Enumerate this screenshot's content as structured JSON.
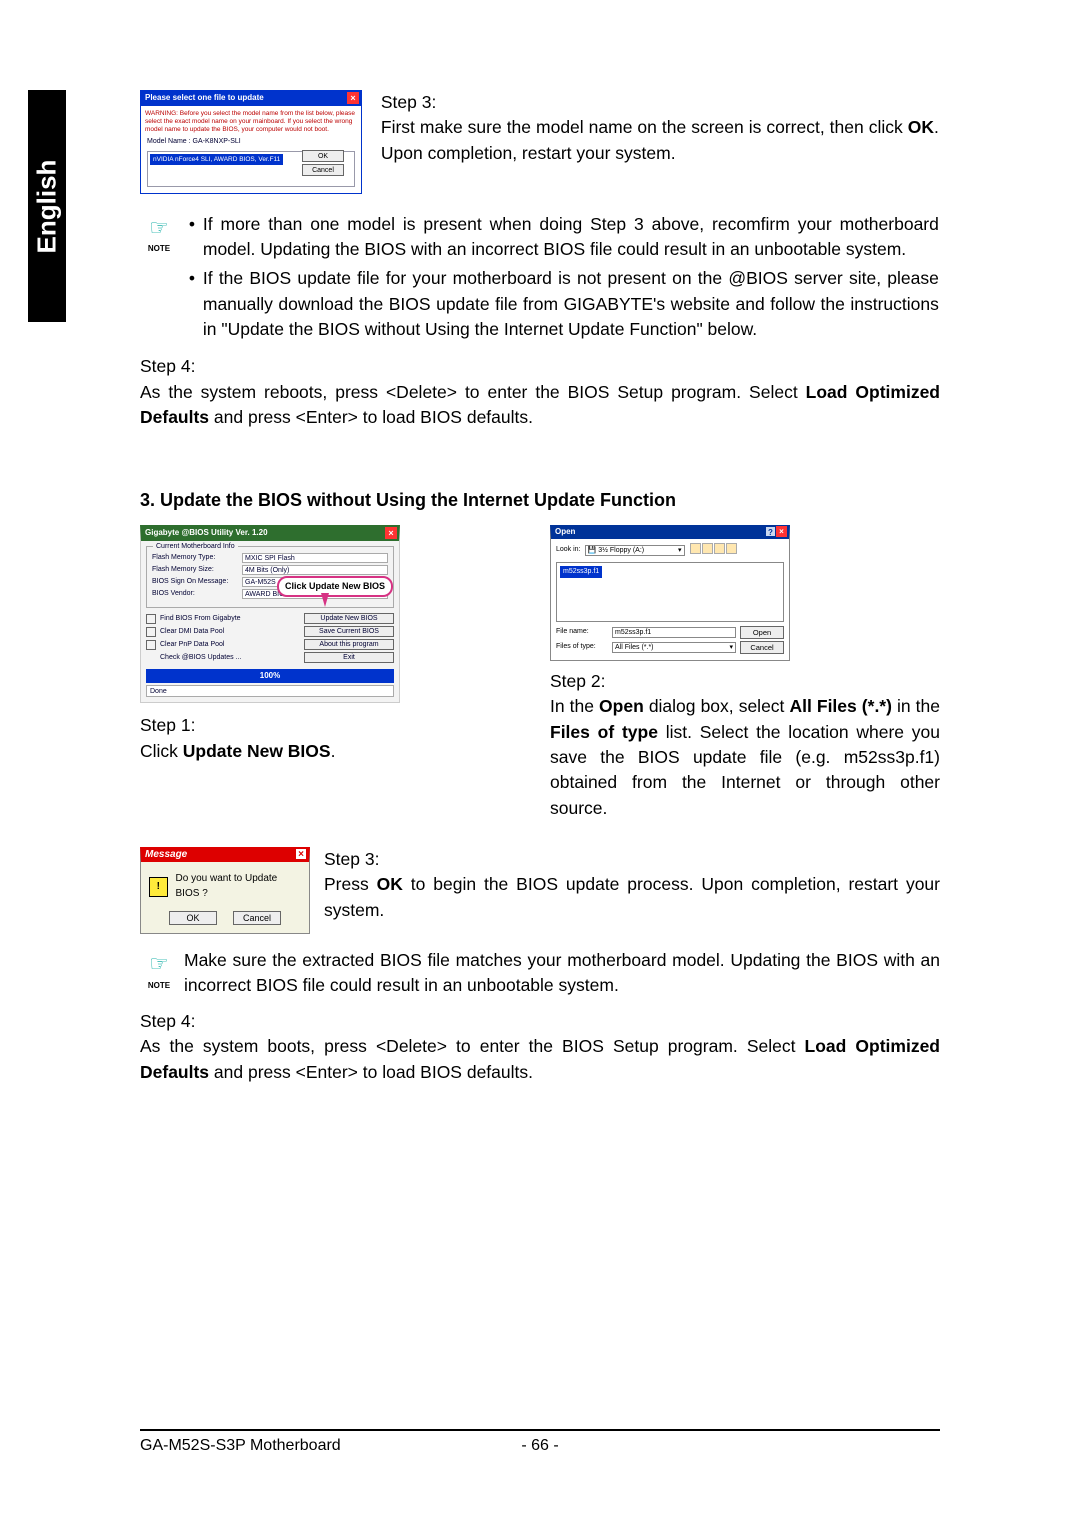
{
  "side_tab": "English",
  "select_dialog": {
    "title": "Please select one file to update",
    "warning": "WARNING: Before you select the model name from the list below, please select the exact model name on your mainboard. If you select the wrong model name to update the BIOS, your computer would not boot.",
    "model_label": "Model Name : GA-K8NXP-SLI",
    "list_item": "nVIDIA nForce4 SLI, AWARD BIOS, Ver.F11",
    "ok": "OK",
    "cancel": "Cancel"
  },
  "step3a": {
    "heading": "Step 3:",
    "p1a": "First make sure the model name on the screen is correct, then click ",
    "p1b": "OK",
    "p1c": ". Upon completion, restart your system."
  },
  "note1": {
    "label": "NOTE",
    "li1": "If more than one model is present when doing Step 3 above, recomfirm your motherboard model. Updating the BIOS with an incorrect BIOS file could result in an unbootable system.",
    "li2": "If the BIOS update file for your motherboard is not present on the @BIOS server site, please manually download the BIOS update file from GIGABYTE's website and follow the instructions in \"Update the BIOS without Using the Internet Update Function\" below."
  },
  "step4a": {
    "heading": "Step 4:",
    "p_a": "As the system reboots, press <Delete> to enter the BIOS Setup program. Select ",
    "p_b": "Load Optimized Defaults",
    "p_c": " and press <Enter> to load BIOS defaults."
  },
  "section3_title": "3.   Update the BIOS without Using the Internet Update Function",
  "utility": {
    "title": "Gigabyte @BIOS Utility Ver. 1.20",
    "group_label": "Current Motherboard Info",
    "r1l": "Flash Memory Type:",
    "r1v": "MXIC SPI Flash",
    "r2l": "Flash Memory Size:",
    "r2v": "4M Bits (Only)",
    "r3l": "BIOS Sign On Message:",
    "r3v": "GA-M52S",
    "r4l": "BIOS Vendor:",
    "r4v": "AWARD BIOS",
    "b1c": "Find BIOS From Gigabyte",
    "b1b": "Update New BIOS",
    "b2c": "Clear DMI Data Pool",
    "b2b": "Save Current BIOS",
    "b3c": "Clear PnP Data Pool",
    "b3b": "About this program",
    "b4c": "Check @BIOS Updates ...",
    "b4b": "Exit",
    "progress": "100%",
    "done": "Done",
    "callout": "Click Update New BIOS"
  },
  "step1": {
    "heading": "Step 1:",
    "p_a": "Click ",
    "p_b": "Update New BIOS",
    "p_c": "."
  },
  "open_dialog": {
    "title": "Open",
    "look_in_label": "Look in:",
    "look_in": "3½ Floppy (A:)",
    "file": "m52ss3p.f1",
    "filename_label": "File name:",
    "filename": "m52ss3p.f1",
    "filetype_label": "Files of type:",
    "filetype": "All Files (*.*)",
    "open": "Open",
    "cancel": "Cancel"
  },
  "step2": {
    "heading": "Step 2:",
    "p_a": "In the ",
    "p_b": "Open",
    "p_c": " dialog box, select  ",
    "p_d": "All Files (*.*)",
    "p_e": " in the ",
    "p_f": "Files of type",
    "p_g": " list. Select the location where you save the BIOS update file (e.g. m52ss3p.f1) obtained from the Internet or through other source."
  },
  "msg": {
    "title": "Message",
    "text": "Do you want to Update BIOS ?",
    "ok": "OK",
    "cancel": "Cancel"
  },
  "step3b": {
    "heading": "Step 3:",
    "p_a": "Press ",
    "p_b": "OK",
    "p_c": " to begin the BIOS update process. Upon completion, restart your system."
  },
  "note2": {
    "label": "NOTE",
    "text": "Make sure the extracted BIOS file matches your motherboard model. Updating the BIOS with an incorrect BIOS file could result in an unbootable system."
  },
  "step4b": {
    "heading": "Step 4:",
    "p_a": "As the system boots, press <Delete> to enter the BIOS Setup program. Select ",
    "p_b": "Load Optimized Defaults",
    "p_c": " and press <Enter> to load BIOS defaults."
  },
  "footer": {
    "left": "GA-M52S-S3P Motherboard",
    "center": "- 66 -"
  }
}
